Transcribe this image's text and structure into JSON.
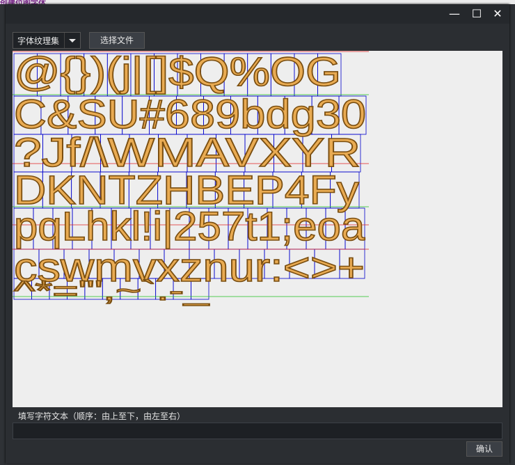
{
  "background": {
    "title": "创建位图字体"
  },
  "window": {
    "minimize_glyph": "—",
    "maximize_glyph": "☐",
    "close_glyph": "✕"
  },
  "toolbar": {
    "texture_select_value": "字体纹理集",
    "choose_file_label": "选择文件"
  },
  "glyph_rows": [
    "@{})(j|[]$Q%OG",
    "C&SU#689bdg30",
    "?Jf/\\WMAVXYR",
    "DKNTZHBEP4Fy",
    "pqLhkl!i|257t1;eoa",
    "cswmvxznur:<>+",
    "^*=\"',~`.-_"
  ],
  "char_input": {
    "label": "填写字符文本（顺序：由上至下，由左至右）",
    "value": "",
    "placeholder": ""
  },
  "confirm_label": "确认",
  "colors": {
    "glyph_fill": "#e9ab52",
    "glyph_outline": "#7a4e10",
    "cell_border": "#0000cc",
    "canvas_bg": "#eeeeee"
  }
}
